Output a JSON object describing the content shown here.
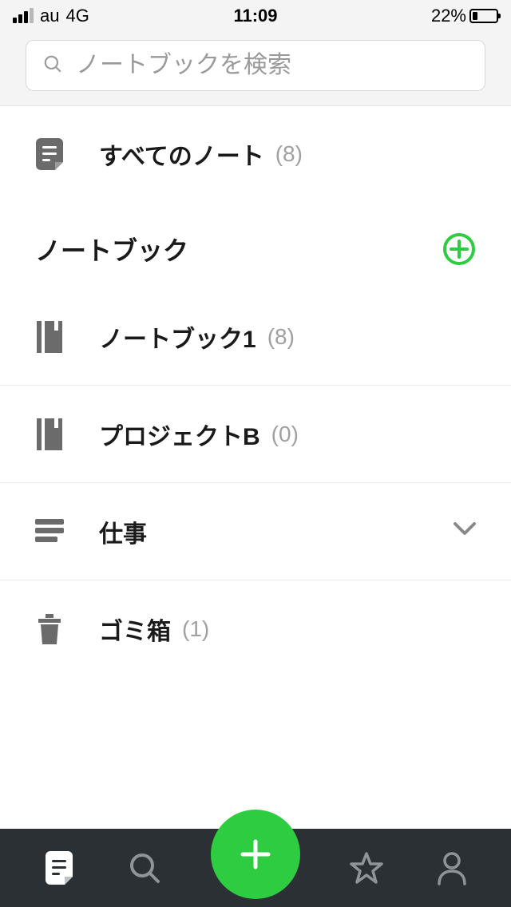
{
  "status": {
    "carrier": "au",
    "network": "4G",
    "time": "11:09",
    "battery_pct": "22%"
  },
  "search": {
    "placeholder": "ノートブックを検索"
  },
  "all_notes": {
    "label": "すべてのノート",
    "count": "(8)"
  },
  "section": {
    "title": "ノートブック"
  },
  "notebooks": [
    {
      "label": "ノートブック1",
      "count": "(8)",
      "icon": "notebook"
    },
    {
      "label": "プロジェクトB",
      "count": "(0)",
      "icon": "notebook"
    },
    {
      "label": "仕事",
      "count": "",
      "icon": "stack",
      "expandable": true
    }
  ],
  "trash": {
    "label": "ゴミ箱",
    "count": "(1)"
  },
  "colors": {
    "accent_green": "#2ecc40",
    "tab_bg": "#2b3034",
    "icon_gray": "#6b6b6b"
  }
}
